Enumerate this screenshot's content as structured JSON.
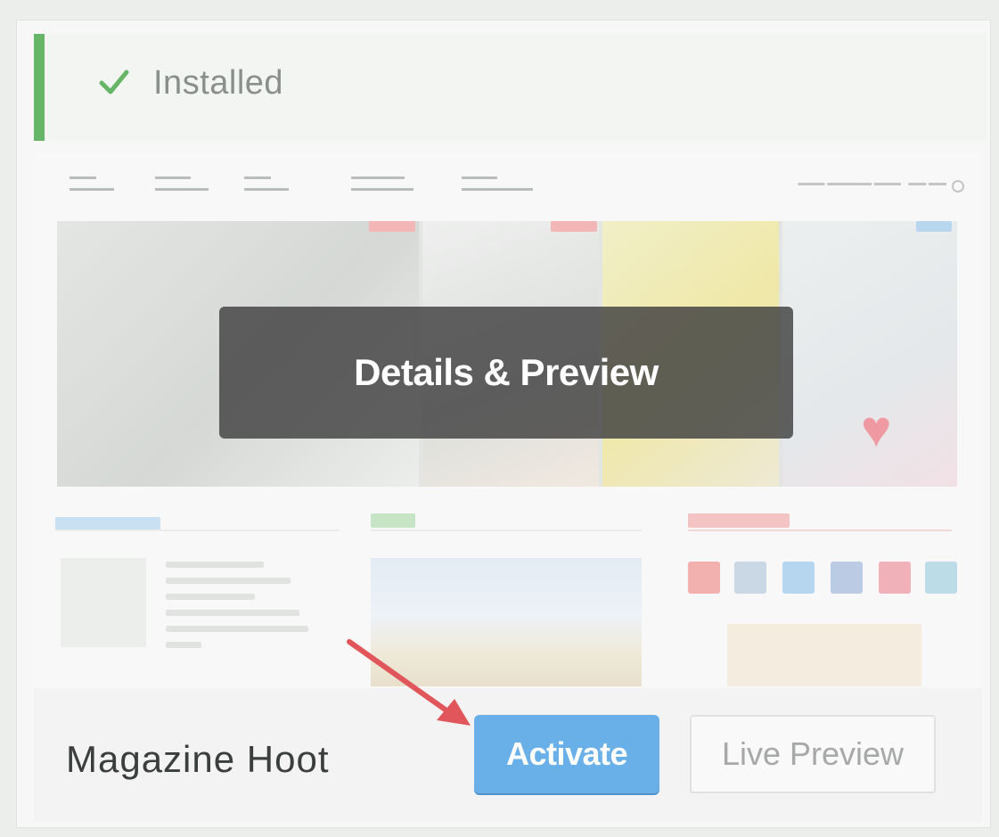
{
  "status": {
    "label": "Installed",
    "icon": "checkmark-icon",
    "accent_color": "#67b567"
  },
  "preview": {
    "overlay_label": "Details & Preview"
  },
  "footer": {
    "theme_name": "Magazine Hoot",
    "activate_label": "Activate",
    "live_preview_label": "Live Preview"
  },
  "colors": {
    "activate_button": "#6ab0e8",
    "annotation_arrow": "#e0565a"
  }
}
